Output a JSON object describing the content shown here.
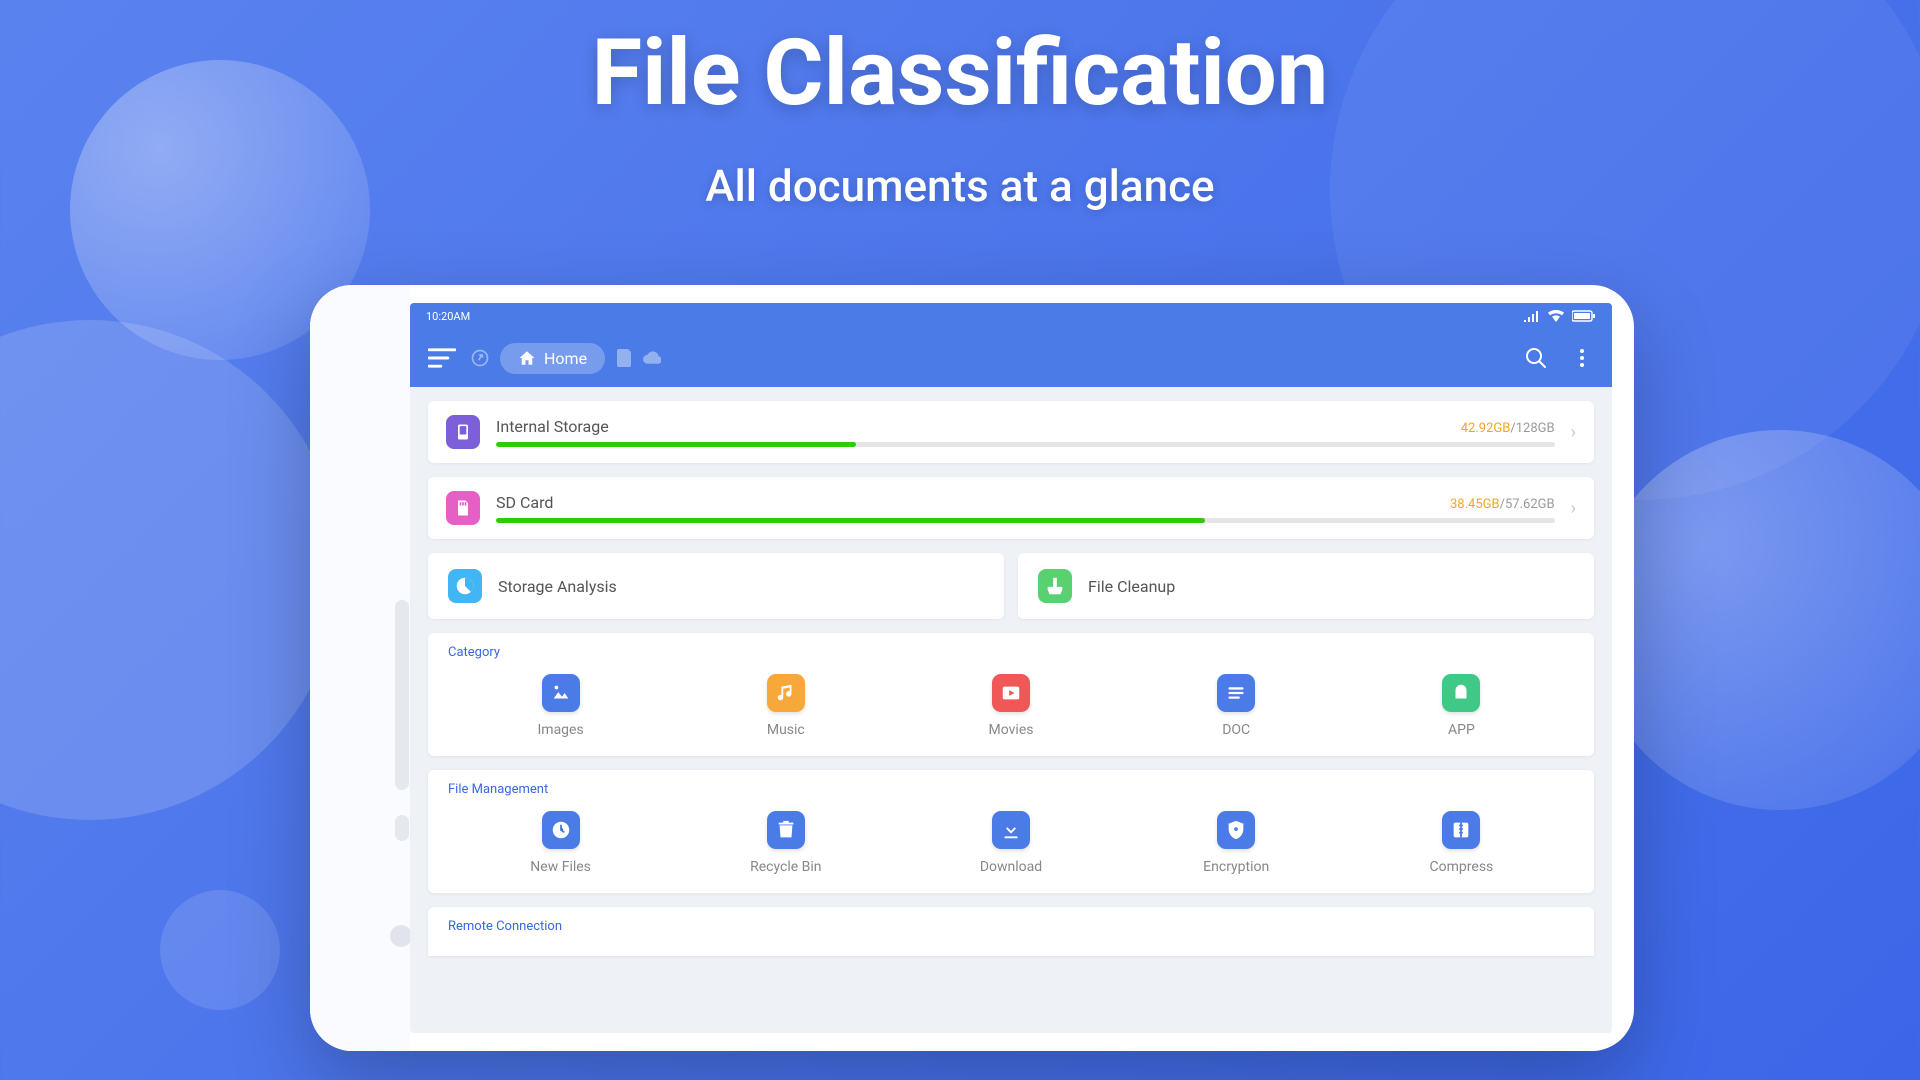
{
  "hero": {
    "title": "File Classification",
    "subtitle": "All documents at a glance"
  },
  "statusbar": {
    "time": "10:20AM"
  },
  "appbar": {
    "home_label": "Home"
  },
  "storage": {
    "internal": {
      "label": "Internal Storage",
      "used": "42.92GB",
      "total": "/128GB",
      "percent": 34
    },
    "sdcard": {
      "label": "SD Card",
      "used": "38.45GB",
      "total": "/57.62GB",
      "percent": 67
    }
  },
  "tools": {
    "analysis": "Storage Analysis",
    "cleanup": "File Cleanup"
  },
  "category": {
    "title": "Category",
    "items": [
      {
        "label": "Images"
      },
      {
        "label": "Music"
      },
      {
        "label": "Movies"
      },
      {
        "label": "DOC"
      },
      {
        "label": "APP"
      }
    ]
  },
  "file_mgmt": {
    "title": "File Management",
    "items": [
      {
        "label": "New Files"
      },
      {
        "label": "Recycle Bin"
      },
      {
        "label": "Download"
      },
      {
        "label": "Encryption"
      },
      {
        "label": "Compress"
      }
    ]
  },
  "remote": {
    "title": "Remote Connection"
  }
}
